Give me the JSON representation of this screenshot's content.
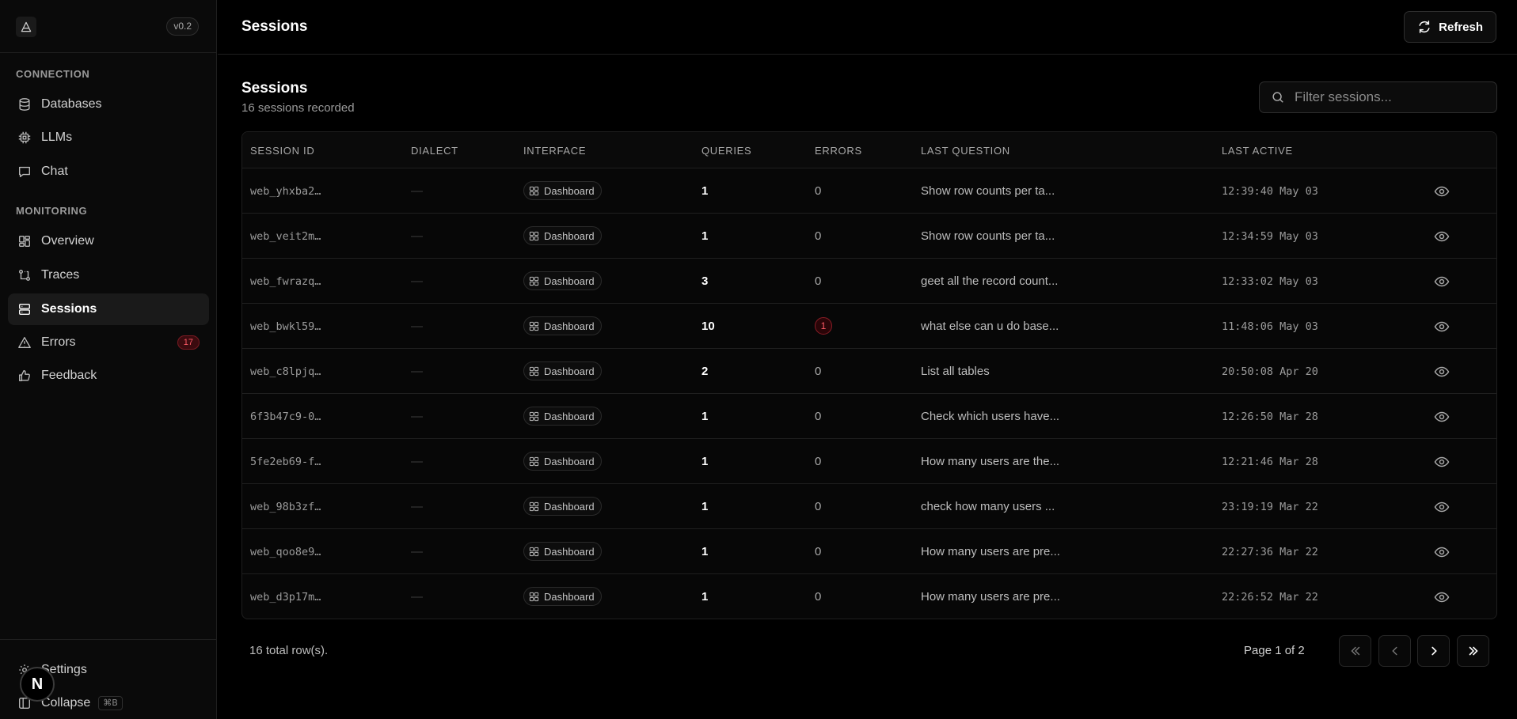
{
  "sidebar": {
    "version": "v0.2",
    "section_connection": "CONNECTION",
    "section_monitoring": "MONITORING",
    "items": [
      {
        "label": "Databases"
      },
      {
        "label": "LLMs"
      },
      {
        "label": "Chat"
      },
      {
        "label": "Overview"
      },
      {
        "label": "Traces"
      },
      {
        "label": "Sessions",
        "active": true
      },
      {
        "label": "Errors",
        "badge": "17"
      },
      {
        "label": "Feedback"
      }
    ],
    "footer": {
      "settings": "Settings",
      "collapse": "Collapse",
      "shortcut": "⌘B"
    },
    "avatar_letter": "N"
  },
  "header": {
    "title": "Sessions",
    "refresh_label": "Refresh"
  },
  "main": {
    "title": "Sessions",
    "subtitle": "16 sessions recorded",
    "filter_placeholder": "Filter sessions..."
  },
  "table": {
    "columns": [
      "SESSION ID",
      "DIALECT",
      "INTERFACE",
      "QUERIES",
      "ERRORS",
      "LAST QUESTION",
      "LAST ACTIVE"
    ],
    "rows": [
      {
        "id": "web_yhxba2…",
        "dialect": "—",
        "interface": "Dashboard",
        "queries": "1",
        "errors": "0",
        "last_question": "Show row counts per ta...",
        "last_active": "12:39:40 May 03"
      },
      {
        "id": "web_veit2m…",
        "dialect": "—",
        "interface": "Dashboard",
        "queries": "1",
        "errors": "0",
        "last_question": "Show row counts per ta...",
        "last_active": "12:34:59 May 03"
      },
      {
        "id": "web_fwrazq…",
        "dialect": "—",
        "interface": "Dashboard",
        "queries": "3",
        "errors": "0",
        "last_question": "geet all the record count...",
        "last_active": "12:33:02 May 03"
      },
      {
        "id": "web_bwkl59…",
        "dialect": "—",
        "interface": "Dashboard",
        "queries": "10",
        "errors": "1",
        "last_question": "what else can u do base...",
        "last_active": "11:48:06 May 03"
      },
      {
        "id": "web_c8lpjq…",
        "dialect": "—",
        "interface": "Dashboard",
        "queries": "2",
        "errors": "0",
        "last_question": "List all tables",
        "last_active": "20:50:08 Apr 20"
      },
      {
        "id": "6f3b47c9-0…",
        "dialect": "—",
        "interface": "Dashboard",
        "queries": "1",
        "errors": "0",
        "last_question": "Check which users have...",
        "last_active": "12:26:50 Mar 28"
      },
      {
        "id": "5fe2eb69-f…",
        "dialect": "—",
        "interface": "Dashboard",
        "queries": "1",
        "errors": "0",
        "last_question": "How many users are the...",
        "last_active": "12:21:46 Mar 28"
      },
      {
        "id": "web_98b3zf…",
        "dialect": "—",
        "interface": "Dashboard",
        "queries": "1",
        "errors": "0",
        "last_question": "check how many users ...",
        "last_active": "23:19:19 Mar 22"
      },
      {
        "id": "web_qoo8e9…",
        "dialect": "—",
        "interface": "Dashboard",
        "queries": "1",
        "errors": "0",
        "last_question": "How many users are pre...",
        "last_active": "22:27:36 Mar 22"
      },
      {
        "id": "web_d3p17m…",
        "dialect": "—",
        "interface": "Dashboard",
        "queries": "1",
        "errors": "0",
        "last_question": "How many users are pre...",
        "last_active": "22:26:52 Mar 22"
      }
    ]
  },
  "pagination": {
    "total": "16 total row(s).",
    "page_info": "Page 1 of 2"
  },
  "colors": {
    "accent_error": "#ff5a66",
    "background": "#000000"
  }
}
